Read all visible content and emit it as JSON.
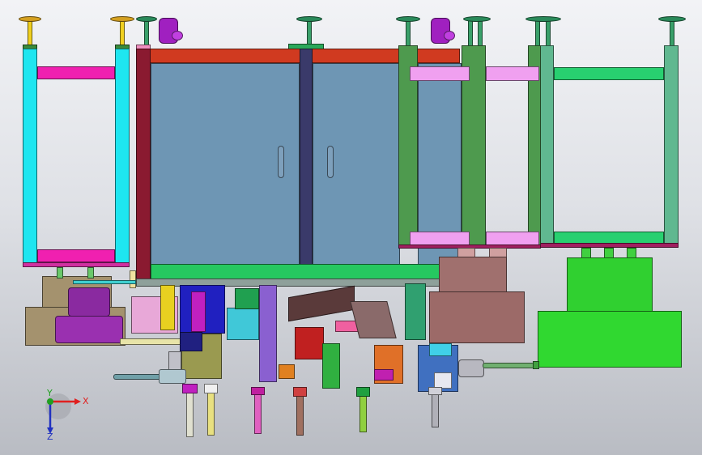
{
  "viewport": {
    "colors": {
      "background_top": "#f2f3f6",
      "background_bottom": "#b9bcc3",
      "outline": "#1a1a1a"
    }
  },
  "triad": {
    "x_label": "X",
    "y_label": "Y",
    "z_label": "Z",
    "colors": {
      "x": "#e02020",
      "y": "#20a020",
      "z": "#2030c0"
    }
  }
}
